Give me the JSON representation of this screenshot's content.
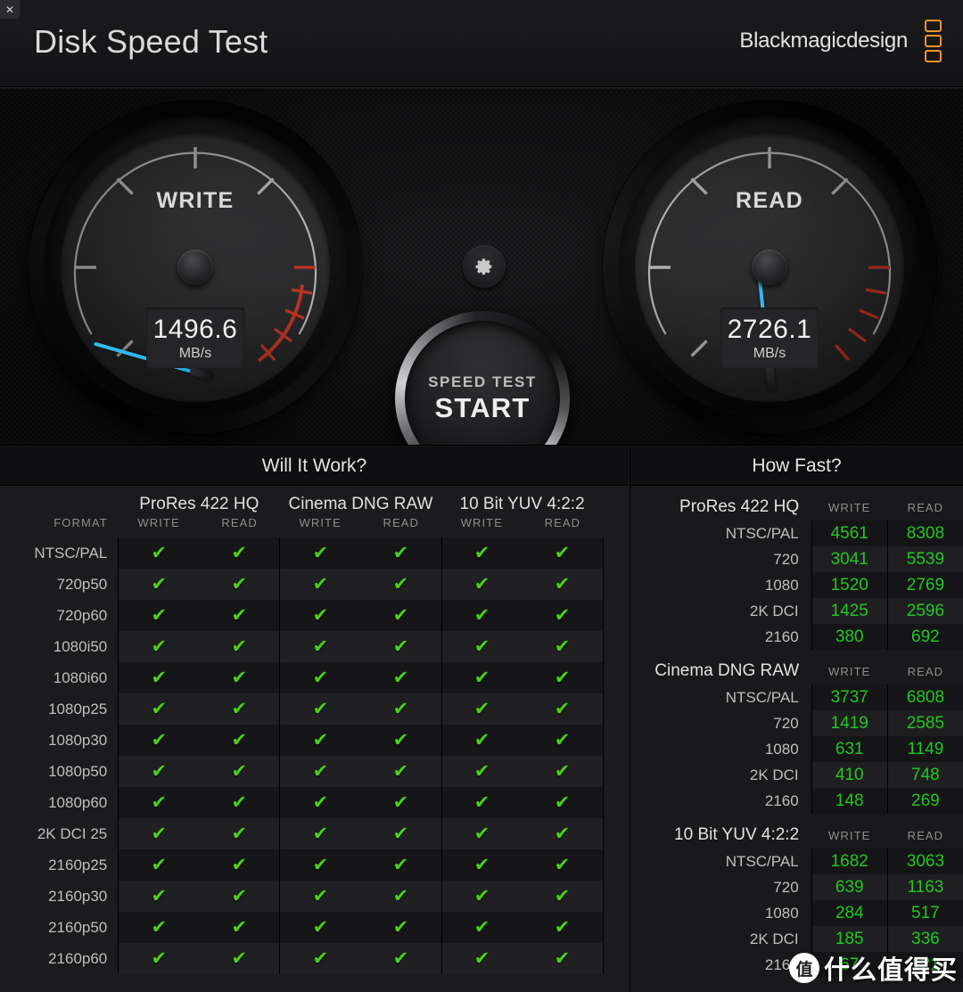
{
  "window": {
    "close_label": "✕"
  },
  "header": {
    "title": "Disk Speed Test",
    "brand": "Blackmagicdesign"
  },
  "gauges": {
    "write": {
      "label": "WRITE",
      "value": "1496.6",
      "unit": "MB/s",
      "needle_deg": -74
    },
    "read": {
      "label": "READ",
      "value": "2726.1",
      "unit": "MB/s",
      "needle_deg": -6
    },
    "accent_needle": "#27b4ea",
    "redzone": "#e03b24"
  },
  "controls": {
    "gear_icon": "gear-icon",
    "start_line1": "SPEED TEST",
    "start_line2": "START"
  },
  "will_it_work": {
    "title": "Will It Work?",
    "format_header": "FORMAT",
    "codecs": [
      "ProRes 422 HQ",
      "Cinema DNG RAW",
      "10 Bit YUV 4:2:2"
    ],
    "sub_headers": [
      "WRITE",
      "READ"
    ],
    "check_glyph": "✔",
    "check_color": "#49d119",
    "rows": [
      {
        "format": "NTSC/PAL",
        "cells": [
          true,
          true,
          true,
          true,
          true,
          true
        ]
      },
      {
        "format": "720p50",
        "cells": [
          true,
          true,
          true,
          true,
          true,
          true
        ]
      },
      {
        "format": "720p60",
        "cells": [
          true,
          true,
          true,
          true,
          true,
          true
        ]
      },
      {
        "format": "1080i50",
        "cells": [
          true,
          true,
          true,
          true,
          true,
          true
        ]
      },
      {
        "format": "1080i60",
        "cells": [
          true,
          true,
          true,
          true,
          true,
          true
        ]
      },
      {
        "format": "1080p25",
        "cells": [
          true,
          true,
          true,
          true,
          true,
          true
        ]
      },
      {
        "format": "1080p30",
        "cells": [
          true,
          true,
          true,
          true,
          true,
          true
        ]
      },
      {
        "format": "1080p50",
        "cells": [
          true,
          true,
          true,
          true,
          true,
          true
        ]
      },
      {
        "format": "1080p60",
        "cells": [
          true,
          true,
          true,
          true,
          true,
          true
        ]
      },
      {
        "format": "2K DCI 25",
        "cells": [
          true,
          true,
          true,
          true,
          true,
          true
        ]
      },
      {
        "format": "2160p25",
        "cells": [
          true,
          true,
          true,
          true,
          true,
          true
        ]
      },
      {
        "format": "2160p30",
        "cells": [
          true,
          true,
          true,
          true,
          true,
          true
        ]
      },
      {
        "format": "2160p50",
        "cells": [
          true,
          true,
          true,
          true,
          true,
          true
        ]
      },
      {
        "format": "2160p60",
        "cells": [
          true,
          true,
          true,
          true,
          true,
          true
        ]
      }
    ]
  },
  "how_fast": {
    "title": "How Fast?",
    "col_write": "WRITE",
    "col_read": "READ",
    "sections": [
      {
        "name": "ProRes 422 HQ",
        "rows": [
          {
            "res": "NTSC/PAL",
            "write": "4561",
            "read": "8308"
          },
          {
            "res": "720",
            "write": "3041",
            "read": "5539"
          },
          {
            "res": "1080",
            "write": "1520",
            "read": "2769"
          },
          {
            "res": "2K DCI",
            "write": "1425",
            "read": "2596"
          },
          {
            "res": "2160",
            "write": "380",
            "read": "692"
          }
        ]
      },
      {
        "name": "Cinema DNG RAW",
        "rows": [
          {
            "res": "NTSC/PAL",
            "write": "3737",
            "read": "6808"
          },
          {
            "res": "720",
            "write": "1419",
            "read": "2585"
          },
          {
            "res": "1080",
            "write": "631",
            "read": "1149"
          },
          {
            "res": "2K DCI",
            "write": "410",
            "read": "748"
          },
          {
            "res": "2160",
            "write": "148",
            "read": "269"
          }
        ]
      },
      {
        "name": "10 Bit YUV 4:2:2",
        "rows": [
          {
            "res": "NTSC/PAL",
            "write": "1682",
            "read": "3063"
          },
          {
            "res": "720",
            "write": "639",
            "read": "1163"
          },
          {
            "res": "1080",
            "write": "284",
            "read": "517"
          },
          {
            "res": "2K DCI",
            "write": "185",
            "read": "336"
          },
          {
            "res": "2160",
            "write": "67",
            "read": "121"
          }
        ]
      }
    ]
  },
  "watermark": {
    "badge": "值",
    "text": "什么值得买"
  }
}
